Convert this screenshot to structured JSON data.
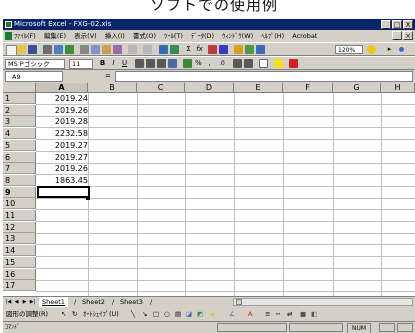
{
  "heading": "ソフトでの使用例",
  "window": {
    "title": "Microsoft Excel - FXG-02.xls",
    "controls": [
      "_",
      "□",
      "X"
    ]
  },
  "menu": {
    "items": [
      "ﾌｧｲﾙ(F)",
      "編集(E)",
      "表示(V)",
      "挿入(I)",
      "書式(O)",
      "ﾂｰﾙ(T)",
      "ﾃﾞｰﾀ(D)",
      "ｳｨﾝﾄﾞｳ(W)",
      "ﾍﾙﾌﾟ(H)",
      "Acrobat"
    ],
    "doc_controls": [
      "_",
      "×"
    ]
  },
  "toolbar": {
    "zoom": "120%",
    "font_name": "MS Pゴシック",
    "font_size": "11",
    "format_labels": [
      "B",
      "I",
      "U"
    ],
    "symbols": [
      "Σ",
      "fx",
      "%",
      ",",
      ".0"
    ]
  },
  "formula_bar": {
    "name_box": "A9",
    "equals": "=",
    "value": ""
  },
  "columns": [
    "A",
    "B",
    "C",
    "D",
    "E",
    "F",
    "G",
    "H"
  ],
  "rows": [
    "1",
    "2",
    "3",
    "4",
    "5",
    "6",
    "7",
    "8",
    "9",
    "10",
    "11",
    "12",
    "13",
    "14",
    "15",
    "16",
    "17"
  ],
  "cells_A": [
    "2019.24",
    "2019.26",
    "2019.28",
    "2232.58",
    "2019.27",
    "2019.27",
    "2019.26",
    "1863.45"
  ],
  "selected": {
    "row": "9",
    "column": "A"
  },
  "tabs": [
    "Sheet1",
    "Sheet2",
    "Sheet3"
  ],
  "tab_separator": "/",
  "drawbar": {
    "draw_label": "図形の調整(R)",
    "autoshape_label": "ｵｰﾄｼｪｲﾌﾟ(U)"
  },
  "status": {
    "text": "ｺﾏﾝﾄﾞ",
    "num": "NUM"
  },
  "colors": {
    "titlebar": "#0a246a",
    "chrome": "#d4d0c8",
    "grid": "#c0c0c0"
  }
}
